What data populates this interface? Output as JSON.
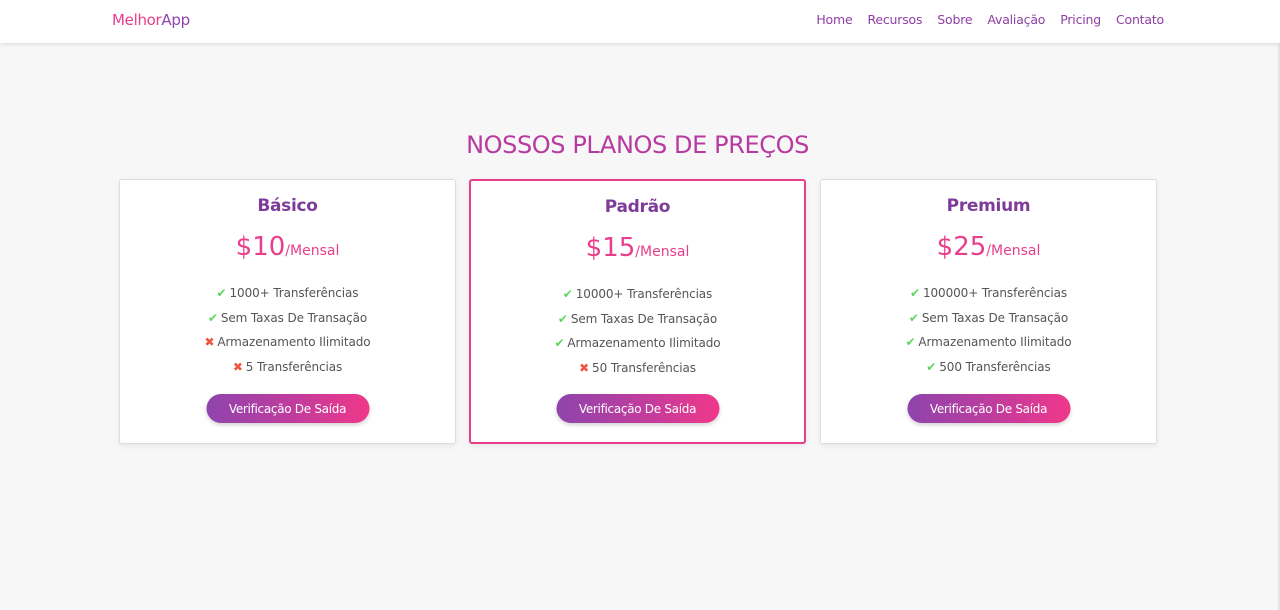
{
  "brand": {
    "part1": "Melhor",
    "part2": "App"
  },
  "nav": {
    "items": [
      "Home",
      "Recursos",
      "Sobre",
      "Avaliação",
      "Pricing",
      "Contato"
    ]
  },
  "pricing": {
    "title": "NOSSOS PLANOS DE PREÇOS",
    "cta_label": "Verificação De Saída",
    "plans": [
      {
        "name": "Básico",
        "price": "$10",
        "period": "/Mensal",
        "featured": false,
        "features": [
          {
            "text": "1000+ Transferências",
            "included": true
          },
          {
            "text": "Sem Taxas De Transação",
            "included": true
          },
          {
            "text": "Armazenamento Ilimitado",
            "included": false
          },
          {
            "text": "5 Transferências",
            "included": false
          }
        ]
      },
      {
        "name": "Padrão",
        "price": "$15",
        "period": "/Mensal",
        "featured": true,
        "features": [
          {
            "text": "10000+ Transferências",
            "included": true
          },
          {
            "text": "Sem Taxas De Transação",
            "included": true
          },
          {
            "text": "Armazenamento Ilimitado",
            "included": true
          },
          {
            "text": "50 Transferências",
            "included": false
          }
        ]
      },
      {
        "name": "Premium",
        "price": "$25",
        "period": "/Mensal",
        "featured": false,
        "features": [
          {
            "text": "100000+ Transferências",
            "included": true
          },
          {
            "text": "Sem Taxas De Transação",
            "included": true
          },
          {
            "text": "Armazenamento Ilimitado",
            "included": true
          },
          {
            "text": "500 Transferências",
            "included": true
          }
        ]
      }
    ]
  },
  "icons": {
    "included": "check-icon",
    "excluded": "cross-icon"
  },
  "colors": {
    "accent_pink": "#e83e8c",
    "accent_purple": "#8e44ad",
    "check_green": "#5cd65c",
    "cross_red": "#f05540"
  }
}
